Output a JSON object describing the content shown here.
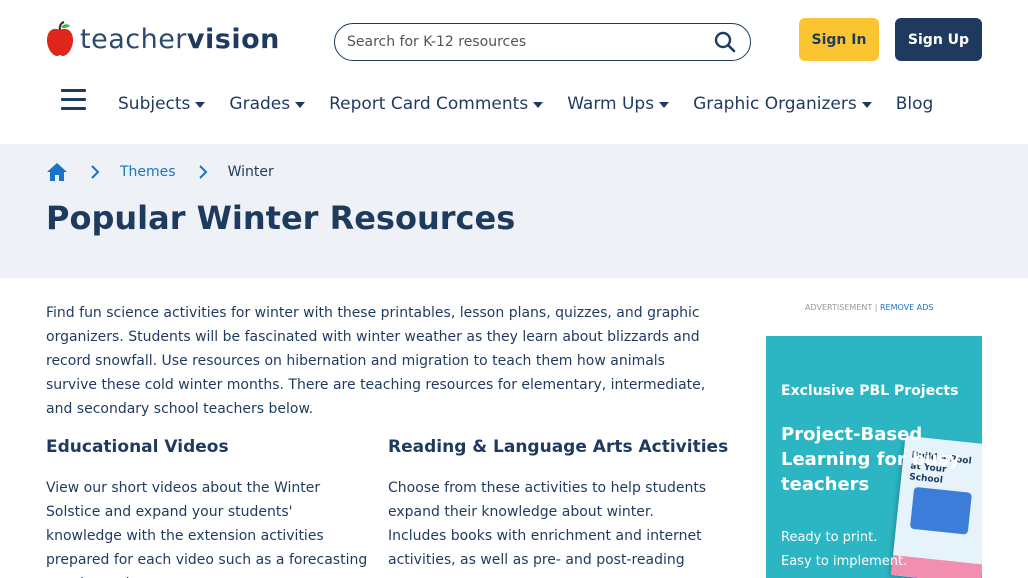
{
  "header": {
    "logo": {
      "part1": "teacher",
      "part2": "vision"
    },
    "search": {
      "placeholder": "Search for K-12 resources"
    },
    "signin_label": "Sign In",
    "signup_label": "Sign Up"
  },
  "nav": {
    "items": [
      {
        "label": "Subjects",
        "dropdown": true
      },
      {
        "label": "Grades",
        "dropdown": true
      },
      {
        "label": "Report Card Comments",
        "dropdown": true
      },
      {
        "label": "Warm Ups",
        "dropdown": true
      },
      {
        "label": "Graphic Organizers",
        "dropdown": true
      },
      {
        "label": "Blog",
        "dropdown": false
      }
    ]
  },
  "breadcrumb": {
    "themes": "Themes",
    "current": "Winter"
  },
  "page": {
    "title": "Popular Winter Resources",
    "intro": "Find fun science activities for winter with these printables, lesson plans, quizzes, and graphic organizers. Students will be fascinated with winter weather as they learn about blizzards and record snowfall. Use resources on hibernation and migration to teach them how animals survive these cold winter months. There are teaching resources for elementary, intermediate, and secondary school teachers below."
  },
  "sections": {
    "videos": {
      "heading": "Educational Videos",
      "text": "View our short videos about the Winter Solstice and expand your students' knowledge with the extension activities prepared for each video such as a forecasting weather quiz."
    },
    "reading": {
      "heading": "Reading & Language Arts Activities",
      "text": "Choose from these activities to help students expand their knowledge about winter. Includes books with enrichment and internet activities, as well as pre- and post-reading"
    }
  },
  "ad": {
    "label": "ADVERTISEMENT |",
    "remove": "REMOVE ADS",
    "kicker": "Exclusive PBL Projects",
    "headline": "Project-Based Learning for busy teachers",
    "book_title": "Build a Pool at Your School",
    "line1": "Ready to print.",
    "line2": "Easy to implement."
  },
  "colors": {
    "brand_navy": "#1f3a5f",
    "signin_yellow": "#fbc531",
    "link_blue": "#1a73c7",
    "band_bg": "#eef1f6",
    "ad_teal": "#2cb5c3"
  }
}
